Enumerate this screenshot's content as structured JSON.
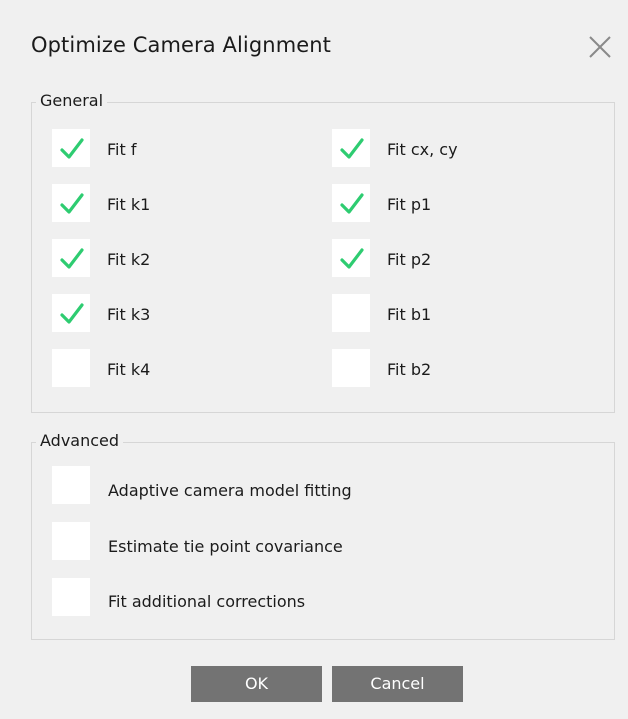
{
  "window": {
    "title": "Optimize Camera Alignment"
  },
  "colors": {
    "check": "#2ecc71",
    "button_bg": "#737373",
    "background": "#f0f0f0"
  },
  "icons": {
    "close": "close-icon",
    "check": "checkmark-icon"
  },
  "general": {
    "label": "General",
    "left": [
      {
        "label": "Fit f",
        "checked": true
      },
      {
        "label": "Fit k1",
        "checked": true
      },
      {
        "label": "Fit k2",
        "checked": true
      },
      {
        "label": "Fit k3",
        "checked": true
      },
      {
        "label": "Fit k4",
        "checked": false
      }
    ],
    "right": [
      {
        "label": "Fit cx, cy",
        "checked": true
      },
      {
        "label": "Fit p1",
        "checked": true
      },
      {
        "label": "Fit p2",
        "checked": true
      },
      {
        "label": "Fit b1",
        "checked": false
      },
      {
        "label": "Fit b2",
        "checked": false
      }
    ]
  },
  "advanced": {
    "label": "Advanced",
    "items": [
      {
        "label": "Adaptive camera model fitting",
        "checked": false
      },
      {
        "label": "Estimate tie point covariance",
        "checked": false
      },
      {
        "label": "Fit additional corrections",
        "checked": false
      }
    ]
  },
  "buttons": {
    "ok": "OK",
    "cancel": "Cancel"
  }
}
